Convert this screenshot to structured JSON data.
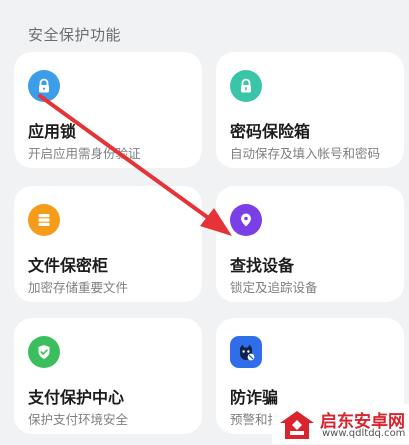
{
  "section": {
    "title": "安全保护功能"
  },
  "cards": [
    {
      "title": "应用锁",
      "desc": "开启应用需身份验证",
      "icon": "lock-icon",
      "color": "#3c9de8"
    },
    {
      "title": "密码保险箱",
      "desc": "自动保存及填入帐号和密码",
      "icon": "key-lock-icon",
      "color": "#39c5a8"
    },
    {
      "title": "文件保密柜",
      "desc": "加密存储重要文件",
      "icon": "file-cabinet-icon",
      "color": "#f59c1a"
    },
    {
      "title": "查找设备",
      "desc": "锁定及追踪设备",
      "icon": "location-pin-icon",
      "color": "#7a3fe6"
    },
    {
      "title": "支付保护中心",
      "desc": "保护支付环境安全",
      "icon": "shield-check-icon",
      "color": "#3bbf5e"
    },
    {
      "title": "防诈骗",
      "desc": "预警和拦",
      "icon": "anti-fraud-icon",
      "color": "#2f6ee8"
    }
  ],
  "watermark": {
    "title": "启东安卓网",
    "url": "www.qdltdq.com"
  },
  "annotation": {
    "arrow_color": "#e63338"
  }
}
